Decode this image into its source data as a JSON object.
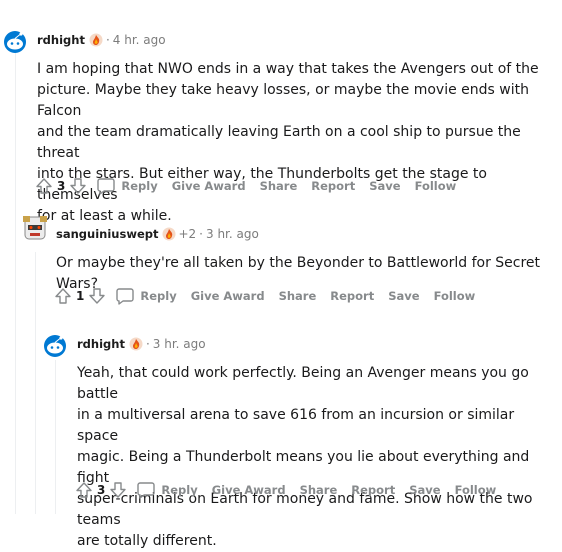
{
  "colors": {
    "text": "#1a1a1b",
    "meta": "#7c7c7c",
    "action": "#878a8c",
    "thread_line": "#edeff1",
    "avatar_blue": "#0079d3"
  },
  "comments": [
    {
      "user": "rdhight",
      "flair_icon": "fire-flair-icon",
      "time": "4 hr. ago",
      "lines": [
        "I am hoping that NWO ends in a way that takes the Avengers out of the",
        "picture. Maybe they take heavy losses, or maybe the movie ends with Falcon",
        "and the team dramatically leaving Earth on a cool ship to pursue the threat",
        "into the stars. But either way, the Thunderbolts get the stage to themselves",
        "for at least a while."
      ],
      "score": "3",
      "actions": {
        "reply": "Reply",
        "award": "Give Award",
        "share": "Share",
        "report": "Report",
        "save": "Save",
        "follow": "Follow"
      }
    },
    {
      "user": "sanguiniuswept",
      "flair_icon": "fire-flair-icon",
      "flair_extra": "+2",
      "time": "3 hr. ago",
      "lines": [
        "Or maybe they're all taken by the Beyonder to Battleworld for Secret Wars?"
      ],
      "score": "1",
      "actions": {
        "reply": "Reply",
        "award": "Give Award",
        "share": "Share",
        "report": "Report",
        "save": "Save",
        "follow": "Follow"
      }
    },
    {
      "user": "rdhight",
      "flair_icon": "fire-flair-icon",
      "time": "3 hr. ago",
      "lines": [
        "Yeah, that could work perfectly. Being an Avenger means you go battle",
        "in a multiversal arena to save 616 from an incursion or similar space",
        "magic. Being a Thunderbolt means you lie about everything and fight",
        "super-criminals on Earth for money and fame. Show how the two teams",
        "are totally different."
      ],
      "score": "3",
      "actions": {
        "reply": "Reply",
        "award": "Give Award",
        "share": "Share",
        "report": "Report",
        "save": "Save",
        "follow": "Follow"
      }
    }
  ],
  "separator": "·"
}
